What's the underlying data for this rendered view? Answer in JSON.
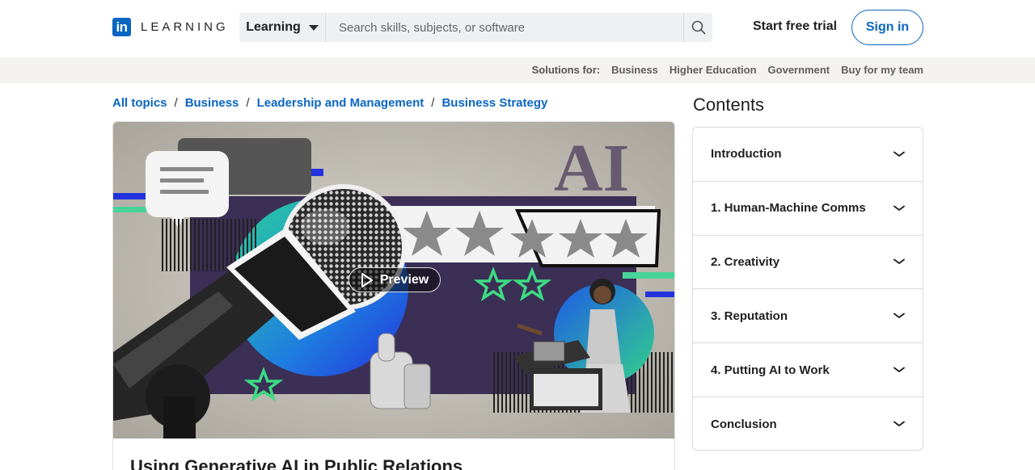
{
  "header": {
    "logo_box": "in",
    "logo_text": "LEARNING",
    "search_scope": "Learning",
    "search_placeholder": "Search skills, subjects, or software",
    "start_trial": "Start free trial",
    "sign_in": "Sign in",
    "icons": [
      "linkedin-logo-icon",
      "caret-down-icon",
      "search-icon"
    ],
    "colors": {
      "brand": "#0a66c2"
    }
  },
  "solutions": {
    "label": "Solutions for:",
    "links": [
      "Business",
      "Higher Education",
      "Government",
      "Buy for my team"
    ]
  },
  "breadcrumb": [
    "All topics",
    "Business",
    "Leadership and Management",
    "Business Strategy"
  ],
  "course": {
    "title": "Using Generative AI in Public Relations",
    "thumbnail_text": "AI",
    "preview_label": "Preview",
    "thumbnail_rating_stars": 5,
    "icons": [
      "play-icon"
    ]
  },
  "contents": {
    "heading": "Contents",
    "sections": [
      {
        "label": "Introduction"
      },
      {
        "label": "1. Human-Machine Comms"
      },
      {
        "label": "2. Creativity"
      },
      {
        "label": "3. Reputation"
      },
      {
        "label": "4. Putting AI to Work"
      },
      {
        "label": "Conclusion"
      }
    ],
    "icons": [
      "chevron-down-icon"
    ]
  }
}
